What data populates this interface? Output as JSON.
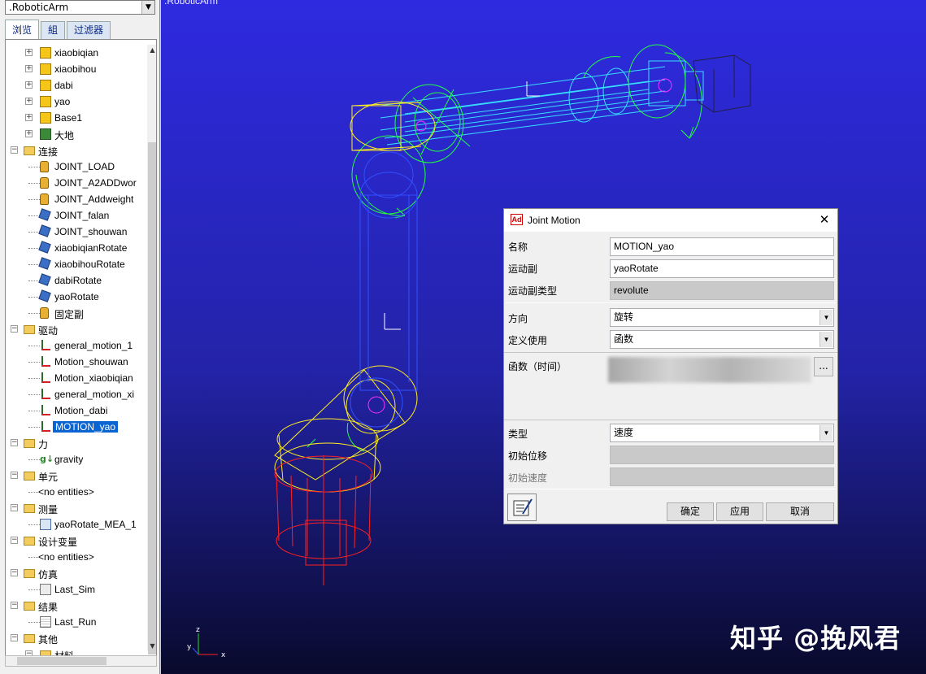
{
  "left_panel": {
    "model_select": ".RoboticArm",
    "tabs": [
      "浏览",
      "組",
      "过滤器"
    ],
    "tree": [
      {
        "label": "xiaobiqian",
        "depth": 1,
        "icon": "part",
        "toggle": "+"
      },
      {
        "label": "xiaobihou",
        "depth": 1,
        "icon": "part",
        "toggle": "+"
      },
      {
        "label": "dabi",
        "depth": 1,
        "icon": "part",
        "toggle": "+"
      },
      {
        "label": "yao",
        "depth": 1,
        "icon": "part",
        "toggle": "+"
      },
      {
        "label": "Base1",
        "depth": 1,
        "icon": "part",
        "toggle": "+"
      },
      {
        "label": "大地",
        "depth": 1,
        "icon": "ground",
        "toggle": "+"
      },
      {
        "label": "连接",
        "depth": 0,
        "icon": "folder",
        "toggle": "-"
      },
      {
        "label": "JOINT_LOAD",
        "depth": 1,
        "icon": "lock",
        "toggle": ""
      },
      {
        "label": "JOINT_A2ADDwor",
        "depth": 1,
        "icon": "lock",
        "toggle": ""
      },
      {
        "label": "JOINT_Addweight",
        "depth": 1,
        "icon": "lock",
        "toggle": ""
      },
      {
        "label": "JOINT_falan",
        "depth": 1,
        "icon": "joint",
        "toggle": ""
      },
      {
        "label": "JOINT_shouwan",
        "depth": 1,
        "icon": "joint",
        "toggle": ""
      },
      {
        "label": "xiaobiqianRotate",
        "depth": 1,
        "icon": "joint",
        "toggle": ""
      },
      {
        "label": "xiaobihouRotate",
        "depth": 1,
        "icon": "joint",
        "toggle": ""
      },
      {
        "label": "dabiRotate",
        "depth": 1,
        "icon": "joint",
        "toggle": ""
      },
      {
        "label": "yaoRotate",
        "depth": 1,
        "icon": "joint",
        "toggle": ""
      },
      {
        "label": "固定副",
        "depth": 1,
        "icon": "lock",
        "toggle": ""
      },
      {
        "label": "驱动",
        "depth": 0,
        "icon": "folder",
        "toggle": "-"
      },
      {
        "label": "general_motion_1",
        "depth": 1,
        "icon": "motion",
        "toggle": ""
      },
      {
        "label": "Motion_shouwan",
        "depth": 1,
        "icon": "motion",
        "toggle": ""
      },
      {
        "label": "Motion_xiaobiqian",
        "depth": 1,
        "icon": "motion",
        "toggle": ""
      },
      {
        "label": "general_motion_xi",
        "depth": 1,
        "icon": "motion",
        "toggle": ""
      },
      {
        "label": "Motion_dabi",
        "depth": 1,
        "icon": "motion",
        "toggle": ""
      },
      {
        "label": "MOTION_yao",
        "depth": 1,
        "icon": "motion",
        "toggle": "",
        "selected": true
      },
      {
        "label": "力",
        "depth": 0,
        "icon": "folder",
        "toggle": "-"
      },
      {
        "label": "gravity",
        "depth": 1,
        "icon": "grav",
        "toggle": ""
      },
      {
        "label": "单元",
        "depth": 0,
        "icon": "folder",
        "toggle": "-"
      },
      {
        "label": "<no entities>",
        "depth": 1,
        "icon": "none",
        "toggle": ""
      },
      {
        "label": "测量",
        "depth": 0,
        "icon": "folder",
        "toggle": "-"
      },
      {
        "label": "yaoRotate_MEA_1",
        "depth": 1,
        "icon": "meas",
        "toggle": ""
      },
      {
        "label": "设计变量",
        "depth": 0,
        "icon": "folder",
        "toggle": "-"
      },
      {
        "label": "<no entities>",
        "depth": 1,
        "icon": "none",
        "toggle": ""
      },
      {
        "label": "仿真",
        "depth": 0,
        "icon": "folder",
        "toggle": "-"
      },
      {
        "label": "Last_Sim",
        "depth": 1,
        "icon": "sim",
        "toggle": ""
      },
      {
        "label": "结果",
        "depth": 0,
        "icon": "folder",
        "toggle": "-"
      },
      {
        "label": "Last_Run",
        "depth": 1,
        "icon": "grid",
        "toggle": ""
      },
      {
        "label": "其他",
        "depth": 0,
        "icon": "folder",
        "toggle": "-"
      },
      {
        "label": "材料",
        "depth": 1,
        "icon": "folder",
        "toggle": "-"
      }
    ]
  },
  "viewport": {
    "title": ".RoboticArm",
    "triad": {
      "x": "x",
      "y": "y",
      "z": "z"
    },
    "watermark": "知乎 @挽风君",
    "colors": {
      "bg_top": "#2e2ae0",
      "bg_bottom": "#090a2c"
    }
  },
  "dialog": {
    "title": "Joint Motion",
    "logo": "Ad",
    "close": "✕",
    "name_label": "名称",
    "name_value": "MOTION_yao",
    "joint_label": "运动副",
    "joint_value": "yaoRotate",
    "joint_type_label": "运动副类型",
    "joint_type_value": "revolute",
    "direction_label": "方向",
    "direction_value": "旋转",
    "define_by_label": "定义使用",
    "define_by_value": "函数",
    "function_label": "函数（时间）",
    "function_browse": "...",
    "type_label": "类型",
    "type_value": "速度",
    "init_disp_label": "初始位移",
    "init_vel_label": "初始速度",
    "ok": "确定",
    "apply": "应用",
    "cancel": "取消"
  }
}
